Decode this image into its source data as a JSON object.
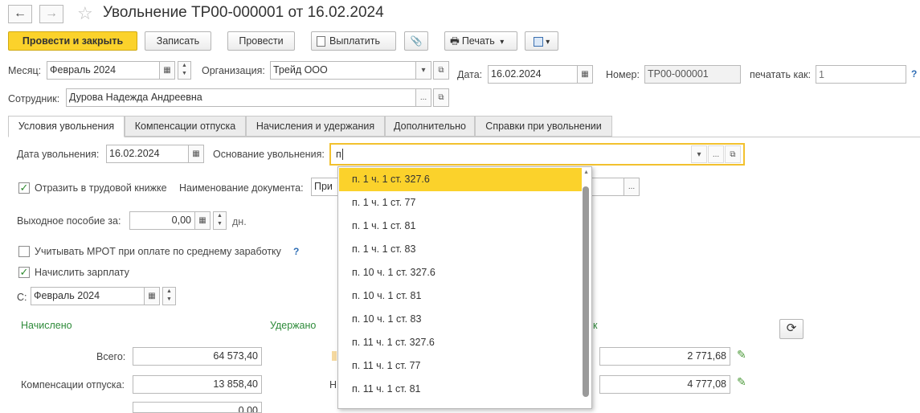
{
  "window": {
    "title": "Увольнение ТР00-000001 от 16.02.2024"
  },
  "toolbar": {
    "post_close": "Провести и закрыть",
    "save": "Записать",
    "post": "Провести",
    "pay": "Выплатить",
    "print": "Печать"
  },
  "header": {
    "month_label": "Месяц:",
    "month_value": "Февраль 2024",
    "org_label": "Организация:",
    "org_value": "Трейд ООО",
    "date_label": "Дата:",
    "date_value": "16.02.2024",
    "number_label": "Номер:",
    "number_value": "ТР00-000001",
    "print_as_label": "печатать как:",
    "print_as_placeholder": "1",
    "help": "?",
    "employee_label": "Сотрудник:",
    "employee_value": "Дурова Надежда Андреевна"
  },
  "tabs": [
    {
      "label": "Условия увольнения"
    },
    {
      "label": "Компенсации отпуска"
    },
    {
      "label": "Начисления и удержания"
    },
    {
      "label": "Дополнительно"
    },
    {
      "label": "Справки при увольнении"
    }
  ],
  "conditions": {
    "dismissal_date_label": "Дата увольнения:",
    "dismissal_date_value": "16.02.2024",
    "basis_label": "Основание увольнения:",
    "basis_value": "п",
    "labor_book_label": "Отразить в трудовой книжке",
    "doc_name_label": "Наименование документа:",
    "doc_name_value": "При",
    "severance_label": "Выходное пособие за:",
    "severance_value": "0,00",
    "severance_unit": "дн.",
    "mrot_label": "Учитывать МРОТ при оплате по среднему заработку",
    "mrot_help": "?",
    "salary_label": "Начислить зарплату",
    "from_label": "С:",
    "from_value": "Февраль 2024"
  },
  "totals": {
    "accrued_header": "Начислено",
    "withheld_header": "Удержано",
    "payout_header_fragment": "к",
    "total_label": "Всего:",
    "total_value": "64 573,40",
    "comp_label": "Компенсации отпуска:",
    "comp_value": "13 858,40",
    "withheld_label_fragment": "Н",
    "right_value_1": "2 771,68",
    "right_value_2": "4 777,08",
    "partial_value": "0,00"
  },
  "dropdown": {
    "items": [
      "п. 1 ч. 1 ст. 327.6",
      "п. 1 ч. 1 ст. 77",
      "п. 1 ч. 1 ст. 81",
      "п. 1 ч. 1 ст. 83",
      "п. 10 ч. 1 ст. 327.6",
      "п. 10 ч. 1 ст. 81",
      "п. 10 ч. 1 ст. 83",
      "п. 11 ч. 1 ст. 327.6",
      "п. 11 ч. 1 ст. 77",
      "п. 11 ч. 1 ст. 81"
    ]
  },
  "icons": {
    "back": "←",
    "forward": "→",
    "star": "☆",
    "calendar": "▦",
    "dots": "...",
    "open": "⧉",
    "caret": "▾",
    "spin_up": "▲",
    "spin_down": "▼",
    "check": "✓",
    "refresh": "⟳",
    "pencil": "✎",
    "clip": "📎",
    "printer": "🖶"
  }
}
